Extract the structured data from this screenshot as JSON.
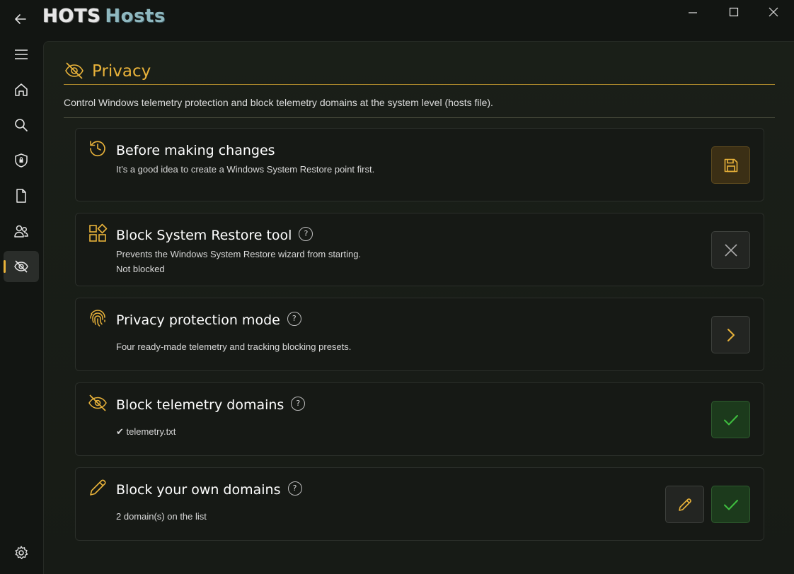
{
  "app": {
    "title_part1": "HOTS",
    "title_part2": "Hosts",
    "colors": {
      "accent": "#e8b23a",
      "title_part2": "#8fb8bf",
      "success": "#3fbf3f"
    }
  },
  "sidebar": {
    "items": [
      {
        "icon": "menu-icon"
      },
      {
        "icon": "home-icon"
      },
      {
        "icon": "search-icon"
      },
      {
        "icon": "shield-icon"
      },
      {
        "icon": "document-icon"
      },
      {
        "icon": "users-icon"
      },
      {
        "icon": "eye-off-icon",
        "active": true
      },
      {
        "icon": "settings-icon"
      }
    ]
  },
  "page": {
    "title": "Privacy",
    "description": "Control Windows telemetry protection and block telemetry domains at the system level (hosts file)."
  },
  "cards": [
    {
      "title": "Before making changes",
      "subtitle": "It's a good idea to create a Windows System Restore point first.",
      "icon": "history-icon",
      "action_icon": "save-icon"
    },
    {
      "title": "Block System Restore tool",
      "subtitle": "Prevents the Windows System Restore wizard from starting.",
      "status": "Not blocked",
      "help": "?",
      "icon": "apps-icon",
      "action_icon": "x-icon"
    },
    {
      "title": "Privacy protection mode",
      "subtitle": "Four ready-made telemetry and tracking blocking presets.",
      "help": "?",
      "icon": "fingerprint-icon",
      "action_icon": "chevron-right-icon"
    },
    {
      "title": "Block telemetry domains",
      "subtitle": "✔  telemetry.txt",
      "help": "?",
      "icon": "eye-off-icon",
      "action_icon": "check-icon"
    },
    {
      "title": "Block your own domains",
      "subtitle": "2 domain(s) on the list",
      "help": "?",
      "icon": "pencil-icon",
      "action_icons": [
        "pencil-icon",
        "check-icon"
      ]
    }
  ]
}
